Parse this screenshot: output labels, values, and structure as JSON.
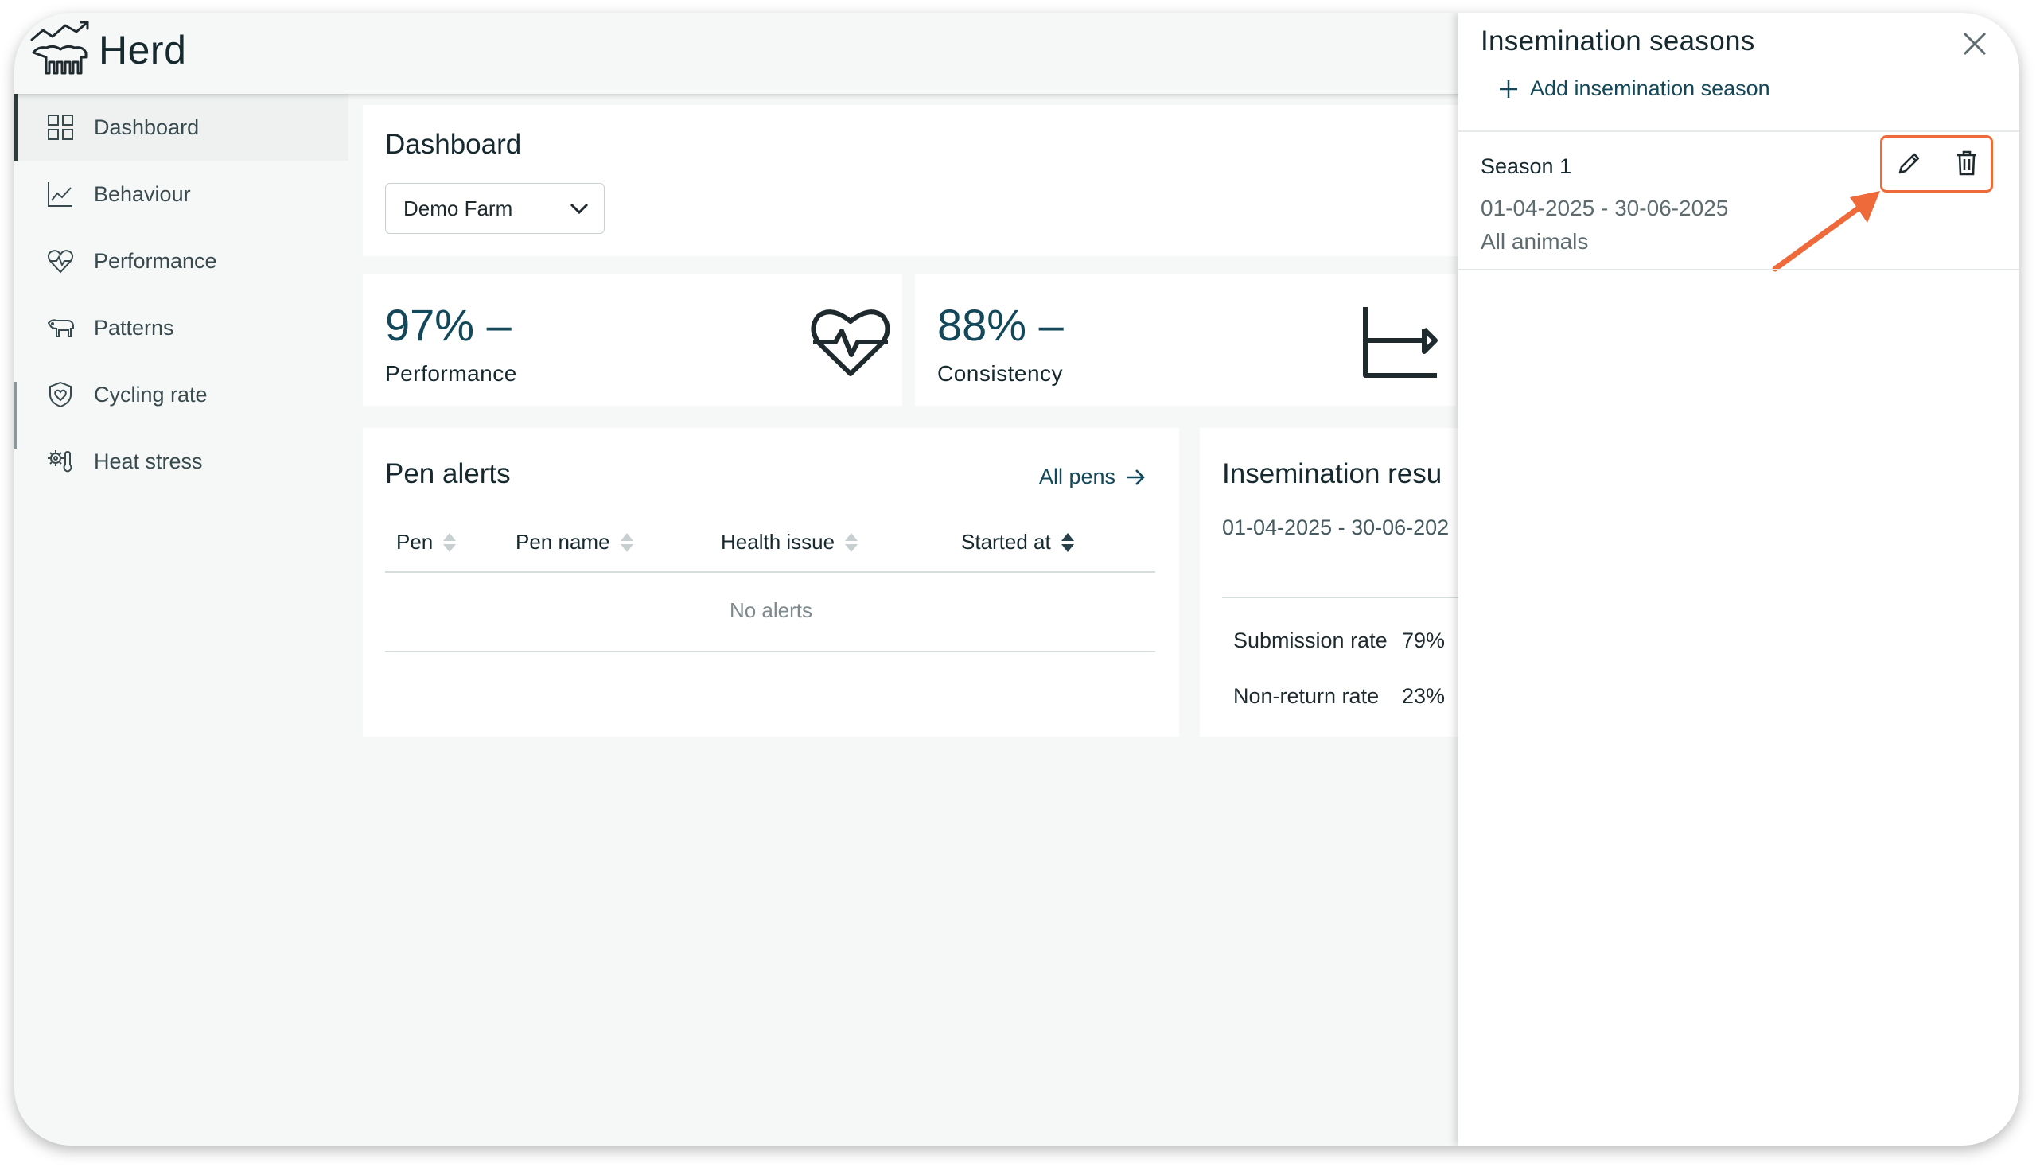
{
  "app": {
    "brand": "Herd"
  },
  "sidebar": {
    "items": [
      {
        "label": "Dashboard",
        "icon": "grid-icon"
      },
      {
        "label": "Behaviour",
        "icon": "line-chart-icon"
      },
      {
        "label": "Performance",
        "icon": "heart-pulse-icon"
      },
      {
        "label": "Patterns",
        "icon": "cow-icon"
      },
      {
        "label": "Cycling rate",
        "icon": "shield-heart-icon"
      },
      {
        "label": "Heat stress",
        "icon": "thermometer-gear-icon"
      }
    ]
  },
  "dashboard": {
    "title": "Dashboard",
    "farm_select": {
      "value": "Demo Farm"
    }
  },
  "kpis": [
    {
      "value": "97% –",
      "label": "Performance",
      "icon": "heart-pulse-icon"
    },
    {
      "value": "88% –",
      "label": "Consistency",
      "icon": "axis-arrow-icon"
    }
  ],
  "pen_alerts": {
    "title": "Pen alerts",
    "all_pens": "All pens",
    "columns": [
      "Pen",
      "Pen name",
      "Health issue",
      "Started at"
    ],
    "empty": "No alerts"
  },
  "insemination_results": {
    "title": "Insemination resu",
    "range": "01-04-2025 - 30-06-202",
    "rows": [
      {
        "label": "Submission rate",
        "value": "79%"
      },
      {
        "label": "Non-return rate",
        "value": "23%"
      }
    ]
  },
  "drawer": {
    "title": "Insemination seasons",
    "add_label": "Add insemination season",
    "season": {
      "name": "Season 1",
      "range": "01-04-2025 - 30-06-2025",
      "scope": "All animals"
    }
  },
  "colors": {
    "accent": "#12485a",
    "highlight": "#ef6a3a",
    "text": "#16292e"
  }
}
